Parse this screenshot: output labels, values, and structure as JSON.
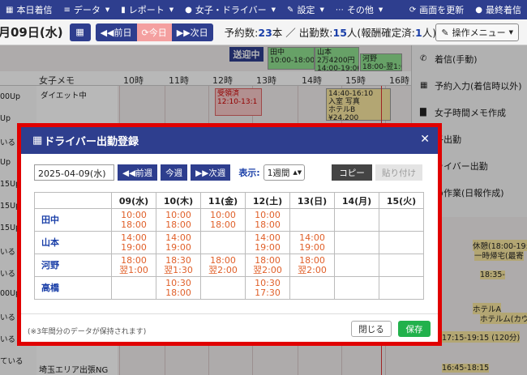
{
  "topnav": [
    {
      "icon": "calendar-icon",
      "glyph": "▦",
      "label": "本日着信",
      "caret": false
    },
    {
      "icon": "database-icon",
      "glyph": "≡",
      "label": "データ",
      "caret": true
    },
    {
      "icon": "chart-icon",
      "glyph": "▮",
      "label": "レポート",
      "caret": true
    },
    {
      "icon": "user-icon",
      "glyph": "●",
      "label": "女子・ドライバー",
      "caret": true
    },
    {
      "icon": "wrench-icon",
      "glyph": "✎",
      "label": "設定",
      "caret": true
    },
    {
      "icon": "more-icon",
      "glyph": "⋯",
      "label": "その他",
      "caret": true
    }
  ],
  "topnav_right": [
    {
      "icon": "refresh-icon",
      "glyph": "⟳",
      "label": "画面を更新"
    },
    {
      "icon": "user-check-icon",
      "glyph": "●",
      "label": "最終着信"
    }
  ],
  "header": {
    "date_title": "月09日(水)",
    "prev_label": "◀◀前日",
    "today_label": "⟳今日",
    "next_label": "▶▶次日",
    "reservation_label": "予約数:",
    "reservation_count": "23",
    "reservation_unit": "本",
    "sep": "／",
    "attendance_label": "出勤数:",
    "attendance_count": "15",
    "attendance_unit": "人",
    "confirmed_label": "(報酬確定済:",
    "confirmed_count": "1",
    "confirmed_unit": "人)",
    "ops_menu_label": "操作メニュー"
  },
  "schedule": {
    "memo_header": "女子メモ",
    "hours": [
      "10時",
      "11時",
      "12時",
      "13時",
      "14時",
      "15時",
      "16時"
    ],
    "memo_first": "ダイエット中",
    "sendoff_label": "送迎中",
    "chip_tanaka": "田中\n10:00-18:00",
    "chip_yamamoto": "山本\n2万4200円\n14:00-19:00",
    "chip_kono": "河野\n18:00-翌1:00",
    "booking1": "受領済\n12:10-13:1",
    "booking2": "14:40-16:10\n入室 写真\nホテルB\n¥24,200",
    "left_rows": [
      "00Up",
      "Up",
      "いる",
      "Up",
      "15Up",
      "15Up",
      "15Up",
      "いる",
      "いる",
      "00Up",
      "いる",
      "いる",
      "ている"
    ],
    "right_texts": [
      "休憩(18:00-19:3",
      "一時帰宅(最寄",
      "18:35-",
      "ホテルA",
      "ホテルム(カウ",
      "17:15-19:15 (120分)",
      "16:45-18:15"
    ],
    "bottom_memo": "埼玉エリア出張NG"
  },
  "dropdown": [
    {
      "icon": "phone-icon",
      "glyph": "✆",
      "label": "着信(手動)"
    },
    {
      "icon": "calendar-check-icon",
      "glyph": "▦",
      "label": "予約入力(着信時以外)"
    },
    {
      "icon": "note-icon",
      "glyph": "▇",
      "label": "女子時間メモ作成"
    },
    {
      "icon": "user-icon",
      "glyph": "",
      "label": "子出勤"
    },
    {
      "icon": "car-icon",
      "glyph": "",
      "label": "ライバー出勤"
    },
    {
      "icon": "task-icon",
      "glyph": "",
      "label": "め作業(日報作成)"
    }
  ],
  "modal": {
    "title": "ドライバー出勤登録",
    "close_glyph": "✕",
    "date_value": "2025-04-09(水)",
    "prev_week": "◀◀前週",
    "this_week": "今週",
    "next_week": "▶▶次週",
    "display_label": "表示:",
    "display_value": "1週間",
    "copy_label": "コピー",
    "paste_label": "貼り付け",
    "columns": [
      "",
      "09(水)",
      "10(木)",
      "11(金)",
      "12(土)",
      "13(日)",
      "14(月)",
      "15(火)"
    ],
    "rows": [
      {
        "name": "田中",
        "cells": [
          "10:00\n18:00",
          "10:00\n18:00",
          "10:00\n18:00",
          "10:00\n18:00",
          "",
          "",
          ""
        ]
      },
      {
        "name": "山本",
        "cells": [
          "14:00\n19:00",
          "14:00\n19:00",
          "",
          "14:00\n19:00",
          "14:00\n19:00",
          "",
          ""
        ]
      },
      {
        "name": "河野",
        "cells": [
          "18:00\n翌1:00",
          "18:30\n翌1:30",
          "18:00\n翌2:00",
          "18:00\n翌2:00",
          "18:00\n翌2:00",
          "",
          ""
        ]
      },
      {
        "name": "高橋",
        "cells": [
          "",
          "10:30\n18:00",
          "",
          "10:30\n17:30",
          "",
          "",
          ""
        ]
      }
    ],
    "footnote": "(※3年間分のデータが保持されます)",
    "close_label": "閉じる",
    "save_label": "保存"
  },
  "colors": {
    "brand": "#2e3e8e",
    "accent_time": "#e0602a",
    "save": "#22b14c",
    "frame": "#e00000"
  }
}
